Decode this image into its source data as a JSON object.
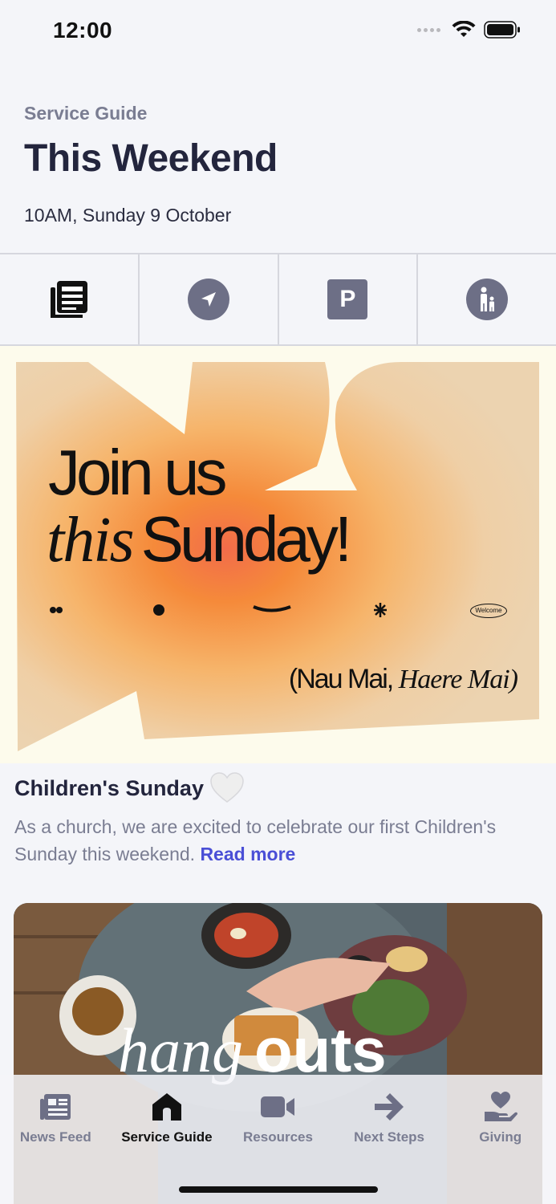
{
  "status_bar": {
    "time": "12:00"
  },
  "header": {
    "eyebrow": "Service Guide",
    "title": "This Weekend",
    "date": "10AM, Sunday 9 October"
  },
  "quick_actions": [
    {
      "icon": "news-icon"
    },
    {
      "icon": "location-arrow-icon"
    },
    {
      "icon": "parking-icon",
      "glyph": "P"
    },
    {
      "icon": "family-icon"
    }
  ],
  "banner": {
    "line1": "Join us",
    "line2_script": "this",
    "line2_main": "Sunday!",
    "sub_main": "(Nau Mai,",
    "sub_script": "Haere Mai)",
    "pill": "Welcome"
  },
  "article": {
    "title": "Children's Sunday",
    "body": "As a church, we are excited to celebrate our first Children's Sunday this weekend.",
    "read_more": "Read more"
  },
  "photo_card": {
    "script": "hang",
    "bold": "outs"
  },
  "tab_bar": {
    "tabs": [
      {
        "label": "News Feed",
        "icon": "newspaper-icon",
        "active": false
      },
      {
        "label": "Service Guide",
        "icon": "home-icon",
        "active": true
      },
      {
        "label": "Resources",
        "icon": "video-camera-icon",
        "active": false
      },
      {
        "label": "Next Steps",
        "icon": "arrow-right-icon",
        "active": false
      },
      {
        "label": "Giving",
        "icon": "heart-hand-icon",
        "active": false
      }
    ]
  },
  "colors": {
    "accent": "#4a4fd6",
    "title": "#23253d",
    "muted": "#7a7d92",
    "icon_fill": "#6d6f86",
    "background": "#f4f5f9"
  }
}
